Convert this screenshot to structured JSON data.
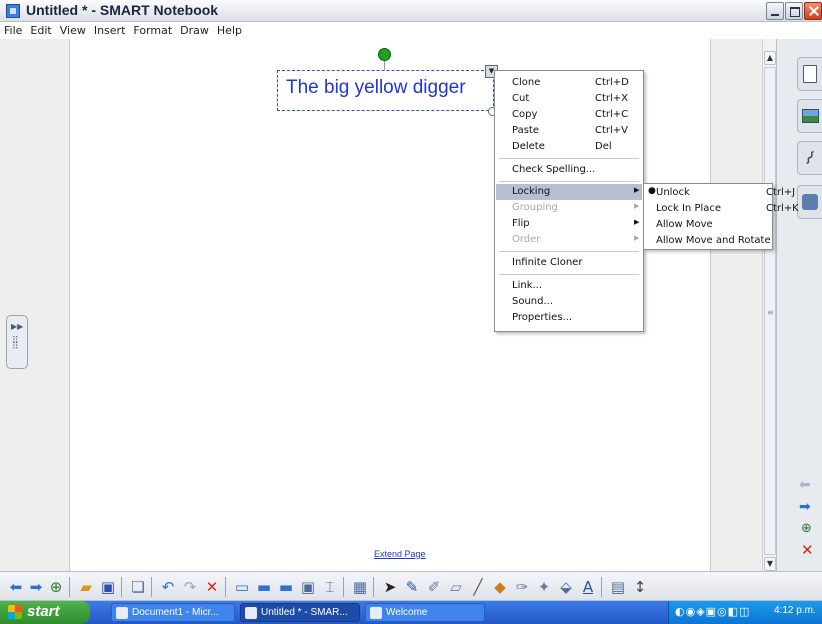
{
  "window": {
    "title": "Untitled * - SMART Notebook"
  },
  "menubar": [
    "File",
    "Edit",
    "View",
    "Insert",
    "Format",
    "Draw",
    "Help"
  ],
  "canvas": {
    "text_object": "The big yellow digger",
    "extend_page_link": "Extend Page"
  },
  "context_menu": {
    "items": [
      {
        "label": "Clone",
        "shortcut": "Ctrl+D"
      },
      {
        "label": "Cut",
        "shortcut": "Ctrl+X"
      },
      {
        "label": "Copy",
        "shortcut": "Ctrl+C"
      },
      {
        "label": "Paste",
        "shortcut": "Ctrl+V"
      },
      {
        "label": "Delete",
        "shortcut": "Del"
      },
      {
        "label": "Check Spelling..."
      },
      {
        "label": "Locking",
        "highlighted": true,
        "submenu": true
      },
      {
        "label": "Grouping",
        "disabled": true,
        "submenu": true
      },
      {
        "label": "Flip",
        "submenu": true
      },
      {
        "label": "Order",
        "disabled": true,
        "submenu": true
      },
      {
        "label": "Infinite Cloner"
      },
      {
        "label": "Link..."
      },
      {
        "label": "Sound..."
      },
      {
        "label": "Properties..."
      }
    ]
  },
  "submenu_locking": {
    "items": [
      {
        "label": "Unlock",
        "shortcut": "Ctrl+J",
        "selected": true
      },
      {
        "label": "Lock In Place",
        "shortcut": "Ctrl+K"
      },
      {
        "label": "Allow Move"
      },
      {
        "label": "Allow Move and Rotate"
      }
    ]
  },
  "taskbar": {
    "start_label": "start",
    "tasks": [
      {
        "label": "Document1 - Micr..."
      },
      {
        "label": "Untitled * - SMAR...",
        "active": true
      },
      {
        "label": "Welcome"
      }
    ],
    "clock": "4:12 p.m."
  },
  "colors": {
    "text_object": "#1f36d0",
    "menu_highlight": "#b8bdd1",
    "taskbar": "#2457c7",
    "start": "#2e8c2d"
  }
}
